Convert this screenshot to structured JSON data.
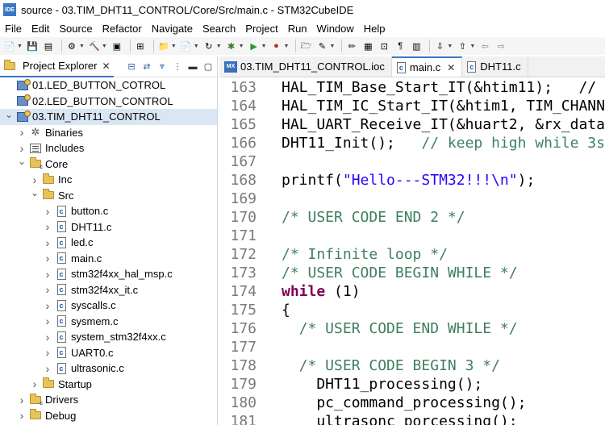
{
  "window": {
    "title": "source - 03.TIM_DHT11_CONTROL/Core/Src/main.c - STM32CubeIDE",
    "app_badge": "IDE"
  },
  "menubar": [
    "File",
    "Edit",
    "Source",
    "Refactor",
    "Navigate",
    "Search",
    "Project",
    "Run",
    "Window",
    "Help"
  ],
  "explorer": {
    "tab_label": "Project Explorer",
    "items": [
      {
        "label": "01.LED_BUTTON_COTROL",
        "depth": 0,
        "icon": "project-icon",
        "arrow": ""
      },
      {
        "label": "02.LED_BUTTON_CONTROL",
        "depth": 0,
        "icon": "project-icon",
        "arrow": ""
      },
      {
        "label": "03.TIM_DHT11_CONTROL",
        "depth": 0,
        "icon": "project-icon",
        "arrow": "down",
        "selected": true
      },
      {
        "label": "Binaries",
        "depth": 1,
        "icon": "binaries-icon",
        "arrow": "right"
      },
      {
        "label": "Includes",
        "depth": 1,
        "icon": "includes-icon",
        "arrow": "right"
      },
      {
        "label": "Core",
        "depth": 1,
        "icon": "source-folder-icon",
        "arrow": "down"
      },
      {
        "label": "Inc",
        "depth": 2,
        "icon": "folder-icon",
        "arrow": "right"
      },
      {
        "label": "Src",
        "depth": 2,
        "icon": "folder-icon",
        "arrow": "down"
      },
      {
        "label": "button.c",
        "depth": 3,
        "icon": "c-file-icon",
        "arrow": "right"
      },
      {
        "label": "DHT11.c",
        "depth": 3,
        "icon": "c-file-icon",
        "arrow": "right"
      },
      {
        "label": "led.c",
        "depth": 3,
        "icon": "c-file-icon",
        "arrow": "right"
      },
      {
        "label": "main.c",
        "depth": 3,
        "icon": "c-file-icon",
        "arrow": "right"
      },
      {
        "label": "stm32f4xx_hal_msp.c",
        "depth": 3,
        "icon": "c-file-icon",
        "arrow": "right"
      },
      {
        "label": "stm32f4xx_it.c",
        "depth": 3,
        "icon": "c-file-icon",
        "arrow": "right"
      },
      {
        "label": "syscalls.c",
        "depth": 3,
        "icon": "c-file-icon",
        "arrow": "right"
      },
      {
        "label": "sysmem.c",
        "depth": 3,
        "icon": "c-file-icon",
        "arrow": "right"
      },
      {
        "label": "system_stm32f4xx.c",
        "depth": 3,
        "icon": "c-file-icon",
        "arrow": "right"
      },
      {
        "label": "UART0.c",
        "depth": 3,
        "icon": "c-file-icon",
        "arrow": "right"
      },
      {
        "label": "ultrasonic.c",
        "depth": 3,
        "icon": "c-file-icon",
        "arrow": "right"
      },
      {
        "label": "Startup",
        "depth": 2,
        "icon": "folder-icon",
        "arrow": "right"
      },
      {
        "label": "Drivers",
        "depth": 1,
        "icon": "source-folder-icon",
        "arrow": "right"
      },
      {
        "label": "Debug",
        "depth": 1,
        "icon": "folder-icon",
        "arrow": "right"
      }
    ]
  },
  "editor": {
    "tabs": [
      {
        "label": "03.TIM_DHT11_CONTROL.ioc",
        "icon": "mx-icon",
        "badge": "MX",
        "active": false
      },
      {
        "label": "main.c",
        "icon": "c-file-icon",
        "badge": "c",
        "active": true
      },
      {
        "label": "DHT11.c",
        "icon": "c-file-icon",
        "badge": "c",
        "active": false
      }
    ],
    "lines": [
      {
        "num": "163",
        "text": "HAL_TIM_Base_Start_IT(&htim11);   //",
        "kind": "code"
      },
      {
        "num": "164",
        "text": "HAL_TIM_IC_Start_IT(&htim1, TIM_CHANN",
        "kind": "code"
      },
      {
        "num": "165",
        "text": "HAL_UART_Receive_IT(&huart2, &rx_data",
        "kind": "code"
      },
      {
        "num": "166",
        "text": "DHT11_Init();   ",
        "comment": "// keep high while 3s",
        "kind": "code"
      },
      {
        "num": "167",
        "text": "",
        "kind": "code"
      },
      {
        "num": "168",
        "text": "printf(",
        "string": "\"Hello---STM32!!!\\n\"",
        "after": ");",
        "kind": "code"
      },
      {
        "num": "169",
        "text": "",
        "kind": "code"
      },
      {
        "num": "170",
        "text": "/* USER CODE END 2 */",
        "kind": "comment"
      },
      {
        "num": "171",
        "text": "",
        "kind": "code"
      },
      {
        "num": "172",
        "text": "/* Infinite loop */",
        "kind": "comment"
      },
      {
        "num": "173",
        "text": "/* USER CODE BEGIN WHILE */",
        "kind": "comment"
      },
      {
        "num": "174",
        "text": "while",
        "after": " (1)",
        "kind": "keyword"
      },
      {
        "num": "175",
        "text": "{",
        "kind": "code"
      },
      {
        "num": "176",
        "text": "  /* USER CODE END WHILE */",
        "kind": "comment"
      },
      {
        "num": "177",
        "text": "",
        "kind": "code"
      },
      {
        "num": "178",
        "text": "  /* USER CODE BEGIN 3 */",
        "kind": "comment"
      },
      {
        "num": "179",
        "text": "    DHT11_processing();",
        "kind": "code"
      },
      {
        "num": "180",
        "text": "    pc_command_processing();",
        "kind": "code"
      },
      {
        "num": "181",
        "text": "    ultrasonc_porcessing();",
        "kind": "code"
      }
    ]
  },
  "colors": {
    "keyword": "#7f0055",
    "comment": "#3f7f5f",
    "string": "#2a00ff",
    "line_number": "#7a7a7a",
    "selection": "#dbe6f4",
    "accent": "#3a77c4"
  }
}
